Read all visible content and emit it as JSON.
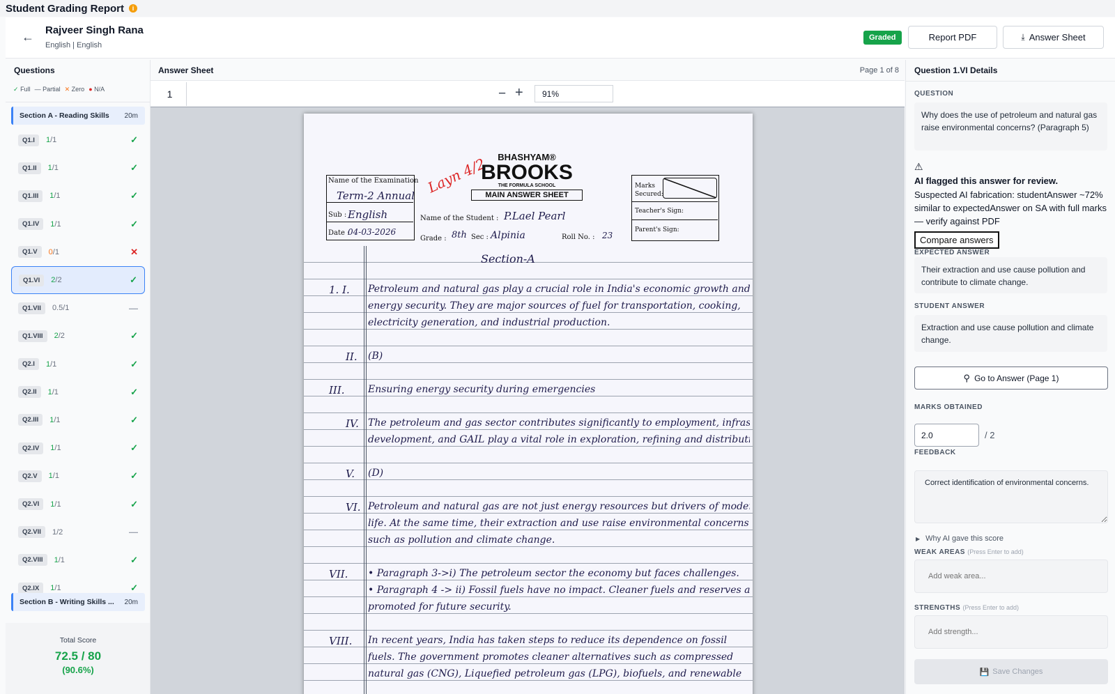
{
  "app": {
    "title": "Student Grading Report",
    "info_icon": "info-icon"
  },
  "header": {
    "student_name": "Rajveer Singh Rana",
    "subject_line": "English | English",
    "status_badge": "Graded",
    "status_color": "#16a34a",
    "report_pdf_label": "Report PDF",
    "answer_sheet_label": "Answer Sheet"
  },
  "sidebar": {
    "title": "Questions",
    "legend": {
      "full": "Full",
      "partial": "Partial",
      "zero": "Zero",
      "na": "N/A"
    },
    "sections": [
      {
        "name": "Section A - Reading Skills",
        "duration": "20m"
      },
      {
        "name": "Section B - Writing Skills ...",
        "duration": "20m"
      }
    ],
    "questions": [
      {
        "id": "Q1.I",
        "score": "1",
        "total": "1",
        "status": "full"
      },
      {
        "id": "Q1.II",
        "score": "1",
        "total": "1",
        "status": "full"
      },
      {
        "id": "Q1.III",
        "score": "1",
        "total": "1",
        "status": "full"
      },
      {
        "id": "Q1.IV",
        "score": "1",
        "total": "1",
        "status": "full"
      },
      {
        "id": "Q1.V",
        "score": "0",
        "total": "1",
        "status": "zero"
      },
      {
        "id": "Q1.VI",
        "score": "2",
        "total": "2",
        "status": "full",
        "active": true
      },
      {
        "id": "Q1.VII",
        "score": "0.5",
        "total": "1",
        "status": "partial"
      },
      {
        "id": "Q1.VIII",
        "score": "2",
        "total": "2",
        "status": "full"
      },
      {
        "id": "Q2.I",
        "score": "1",
        "total": "1",
        "status": "full"
      },
      {
        "id": "Q2.II",
        "score": "1",
        "total": "1",
        "status": "full"
      },
      {
        "id": "Q2.III",
        "score": "1",
        "total": "1",
        "status": "full"
      },
      {
        "id": "Q2.IV",
        "score": "1",
        "total": "1",
        "status": "full"
      },
      {
        "id": "Q2.V",
        "score": "1",
        "total": "1",
        "status": "full"
      },
      {
        "id": "Q2.VI",
        "score": "1",
        "total": "1",
        "status": "full"
      },
      {
        "id": "Q2.VII",
        "score": "1",
        "total": "2",
        "status": "partial"
      },
      {
        "id": "Q2.VIII",
        "score": "1",
        "total": "1",
        "status": "full"
      },
      {
        "id": "Q2.IX",
        "score": "1",
        "total": "1",
        "status": "full"
      }
    ],
    "total_label": "Total Score",
    "total_value": "72.5 / 80",
    "total_pct": "(90.6%)"
  },
  "viewer": {
    "title": "Answer Sheet",
    "page_info": "Page 1 of 8",
    "page_number": "1",
    "zoom": "91%"
  },
  "sheet": {
    "brand_top": "BHASHYAM®",
    "brand_main": "BROOKS",
    "brand_sub": "THE FORMULA SCHOOL",
    "sheet_title": "MAIN ANSWER SHEET",
    "exam_label": "Name of the Examination",
    "exam_value": "Term-2 Annual",
    "sub_label": "Sub :",
    "sub_value": "English",
    "date_label": "Date :",
    "date_value": "04-03-2026",
    "student_label": "Name of the Student :",
    "student_value": "P.Lael Pearl",
    "grade_label": "Grade :",
    "grade_value": "8th",
    "sec_label": "Sec :",
    "sec_value": "Alpinia",
    "roll_label": "Roll No. :",
    "roll_value": "23",
    "marks_label": "Marks Secured:",
    "teacher_label": "Teacher's Sign:",
    "parent_label": "Parent's Sign:",
    "red_mark": "Layn 4/2",
    "section_heading": "Section-A",
    "lines": [
      {
        "num": "1. I.",
        "text": "Petroleum and natural gas play a crucial role in India's economic growth and"
      },
      {
        "num": "",
        "text": "energy security. They are major sources of fuel for transportation, cooking,"
      },
      {
        "num": "",
        "text": "electricity generation, and industrial production."
      },
      {
        "num": "",
        "text": ""
      },
      {
        "num": "II.",
        "text": "(B)"
      },
      {
        "num": "",
        "text": ""
      },
      {
        "num": "III.",
        "text": "Ensuring energy security during emergencies"
      },
      {
        "num": "",
        "text": ""
      },
      {
        "num": "IV.",
        "text": "The petroleum and gas sector contributes significantly to employment, infrastructure"
      },
      {
        "num": "",
        "text": "development, and GAIL play a vital role in exploration, refining and distribution"
      },
      {
        "num": "",
        "text": ""
      },
      {
        "num": "V.",
        "text": "(D)"
      },
      {
        "num": "",
        "text": ""
      },
      {
        "num": "VI.",
        "text": "Petroleum and natural gas are not just energy resources but drivers of modern"
      },
      {
        "num": "",
        "text": "life. At the same time, their extraction and use raise environmental concerns"
      },
      {
        "num": "",
        "text": "such as pollution and climate change."
      },
      {
        "num": "",
        "text": ""
      },
      {
        "num": "VII.",
        "text": "• Paragraph 3->i) The petroleum sector the economy but faces challenges."
      },
      {
        "num": "",
        "text": "• Paragraph 4 -> ii) Fossil fuels have no impact. Cleaner fuels and reserves are"
      },
      {
        "num": "",
        "text": "promoted for future security."
      },
      {
        "num": "",
        "text": ""
      },
      {
        "num": "VIII.",
        "text": "In recent years, India has taken steps to reduce its dependence on fossil"
      },
      {
        "num": "",
        "text": "fuels. The government promotes cleaner alternatives such as compressed"
      },
      {
        "num": "",
        "text": "natural gas (CNG), Liquefied petroleum gas (LPG), biofuels, and renewable"
      }
    ]
  },
  "details": {
    "title": "Question 1.VI Details",
    "question_caption": "QUESTION",
    "question_text": "Why does the use of petroleum and natural gas raise environmental concerns? (Paragraph 5)",
    "flag_title": "AI flagged this answer for review.",
    "flag_text": "Suspected AI fabrication: studentAnswer ~72% similar to expectedAnswer on SA with full marks — verify against PDF",
    "compare_label": "Compare answers",
    "expected_caption": "EXPECTED ANSWER",
    "expected_text": "Their extraction and use cause pollution and contribute to climate change.",
    "student_caption": "STUDENT ANSWER",
    "student_text": "Extraction and use cause pollution and climate change.",
    "goto_label": "Go to Answer (Page 1)",
    "marks_caption": "MARKS OBTAINED",
    "marks_value": "2.0",
    "marks_total": "/ 2",
    "feedback_caption": "FEEDBACK",
    "feedback_text": "Correct identification of environmental concerns.",
    "why_label": "Why AI gave this score",
    "weak_caption": "WEAK AREAS",
    "weak_hint": "(Press Enter to add)",
    "weak_placeholder": "Add weak area...",
    "strengths_caption": "STRENGTHS",
    "strengths_hint": "(Press Enter to add)",
    "strengths_placeholder": "Add strength...",
    "save_label": "Save Changes"
  }
}
